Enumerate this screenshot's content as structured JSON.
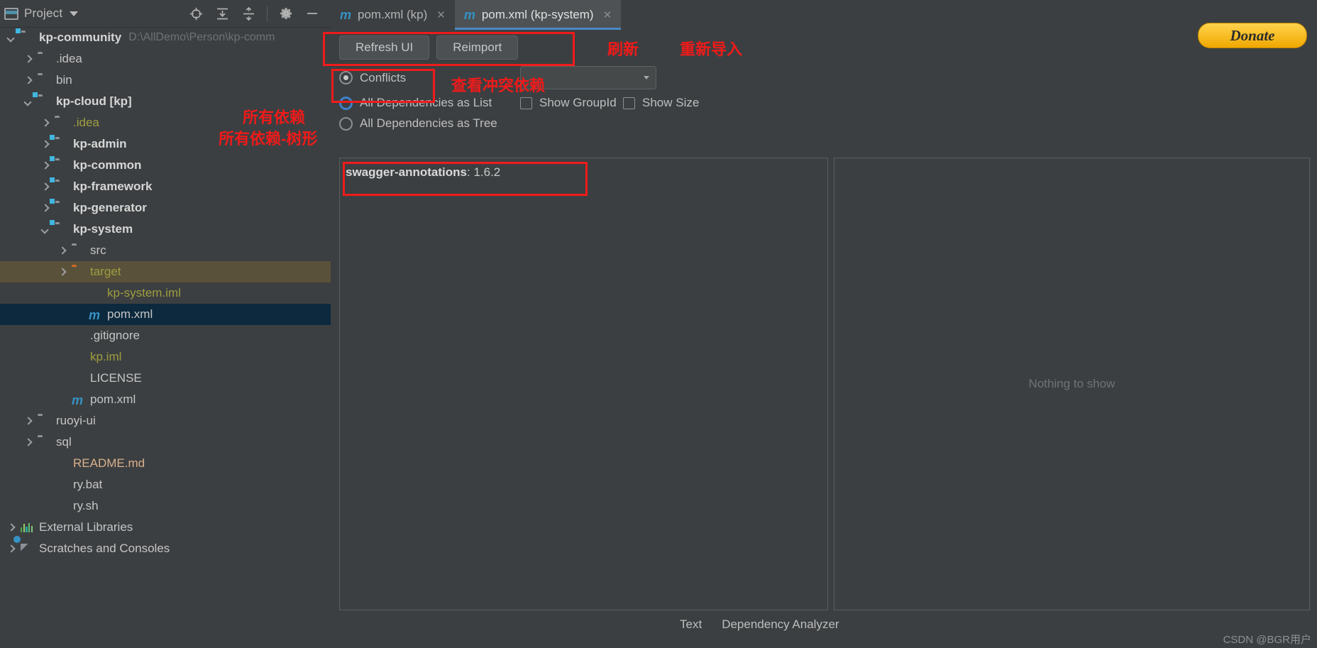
{
  "sidebar": {
    "title": "Project",
    "icons": [
      "project-window-icon",
      "chevron-down-icon",
      "locate-icon",
      "expand-all-icon",
      "collapse-all-icon",
      "gear-icon",
      "minimize-icon"
    ],
    "tree": [
      {
        "label": "kp-community",
        "path": "D:\\AllDemo\\Person\\kp-comm",
        "icon": "module-folder-icon",
        "arrow": "open",
        "indent": 0,
        "style": "bold"
      },
      {
        "label": ".idea",
        "icon": "folder-icon",
        "arrow": "closed",
        "indent": 1,
        "style": "normal"
      },
      {
        "label": "bin",
        "icon": "folder-icon",
        "arrow": "closed",
        "indent": 1,
        "style": "normal"
      },
      {
        "label": "kp-cloud [kp]",
        "icon": "module-folder-icon",
        "arrow": "open",
        "indent": 1,
        "style": "bold"
      },
      {
        "label": ".idea",
        "icon": "folder-icon",
        "arrow": "closed",
        "indent": 2,
        "style": "yellow"
      },
      {
        "label": "kp-admin",
        "icon": "module-folder-icon",
        "arrow": "closed",
        "indent": 2,
        "style": "bold"
      },
      {
        "label": "kp-common",
        "icon": "module-folder-icon",
        "arrow": "closed",
        "indent": 2,
        "style": "bold"
      },
      {
        "label": "kp-framework",
        "icon": "module-folder-icon",
        "arrow": "closed",
        "indent": 2,
        "style": "bold"
      },
      {
        "label": "kp-generator",
        "icon": "module-folder-icon",
        "arrow": "closed",
        "indent": 2,
        "style": "bold"
      },
      {
        "label": "kp-system",
        "icon": "module-folder-icon",
        "arrow": "open",
        "indent": 2,
        "style": "bold"
      },
      {
        "label": "src",
        "icon": "folder-icon",
        "arrow": "closed",
        "indent": 3,
        "style": "normal"
      },
      {
        "label": "target",
        "icon": "folder-excluded-icon",
        "arrow": "closed",
        "indent": 3,
        "style": "yellow",
        "row": "highlight"
      },
      {
        "label": "kp-system.iml",
        "icon": "iml-file-icon",
        "arrow": "none",
        "indent": 4,
        "style": "yellow"
      },
      {
        "label": "pom.xml",
        "icon": "maven-file-icon",
        "arrow": "none",
        "indent": 4,
        "style": "normal",
        "row": "selected"
      },
      {
        "label": ".gitignore",
        "icon": "gitignore-file-icon",
        "arrow": "none",
        "indent": 3,
        "style": "normal"
      },
      {
        "label": "kp.iml",
        "icon": "iml-file-icon",
        "arrow": "none",
        "indent": 3,
        "style": "yellow"
      },
      {
        "label": "LICENSE",
        "icon": "text-file-icon",
        "arrow": "none",
        "indent": 3,
        "style": "normal"
      },
      {
        "label": "pom.xml",
        "icon": "maven-file-icon",
        "arrow": "none",
        "indent": 3,
        "style": "normal"
      },
      {
        "label": "ruoyi-ui",
        "icon": "folder-icon",
        "arrow": "closed",
        "indent": 1,
        "style": "normal"
      },
      {
        "label": "sql",
        "icon": "folder-icon",
        "arrow": "closed",
        "indent": 1,
        "style": "normal"
      },
      {
        "label": "README.md",
        "icon": "markdown-file-icon",
        "arrow": "none",
        "indent": 2,
        "style": "peach"
      },
      {
        "label": "ry.bat",
        "icon": "bat-file-icon",
        "arrow": "none",
        "indent": 2,
        "style": "normal"
      },
      {
        "label": "ry.sh",
        "icon": "shell-file-icon",
        "arrow": "none",
        "indent": 2,
        "style": "normal"
      },
      {
        "label": "External Libraries",
        "icon": "libraries-icon",
        "arrow": "closed",
        "indent": 0,
        "style": "normal"
      },
      {
        "label": "Scratches and Consoles",
        "icon": "scratches-icon",
        "arrow": "closed",
        "indent": 0,
        "style": "normal"
      }
    ]
  },
  "tabs": [
    {
      "label": "pom.xml (kp)",
      "icon": "maven-file-icon",
      "active": false,
      "closable": true
    },
    {
      "label": "pom.xml (kp-system)",
      "icon": "maven-file-icon",
      "active": true,
      "closable": true
    }
  ],
  "analyzer": {
    "buttons": [
      {
        "label": "Refresh UI",
        "name": "refresh-ui-button"
      },
      {
        "label": "Reimport",
        "name": "reimport-button"
      }
    ],
    "radios": [
      {
        "label": "Conflicts",
        "selected": true,
        "focused": false
      },
      {
        "label": "All Dependencies as List",
        "selected": false,
        "focused": true
      },
      {
        "label": "All Dependencies as Tree",
        "selected": false,
        "focused": false
      }
    ],
    "checkboxes": [
      {
        "label": "Show GroupId",
        "checked": false
      },
      {
        "label": "Show Size",
        "checked": false
      }
    ],
    "scope_combo_value": "",
    "dependency": {
      "name": "swagger-annotations",
      "separator": ":",
      "version": "1.6.2"
    },
    "right_pane_empty_text": "Nothing to show"
  },
  "bottom_tabs": [
    {
      "label": "Text"
    },
    {
      "label": "Dependency Analyzer"
    }
  ],
  "donate": {
    "label": "Donate"
  },
  "annotations": [
    {
      "text": "刷新",
      "name": "annotation-refresh"
    },
    {
      "text": "重新导入",
      "name": "annotation-reimport"
    },
    {
      "text": "查看冲突依赖",
      "name": "annotation-view-conflicts"
    },
    {
      "text": "所有依赖",
      "name": "annotation-all-dependencies"
    },
    {
      "text": "所有依赖-树形",
      "name": "annotation-all-dependencies-tree"
    }
  ],
  "watermark": "CSDN @BGR用户",
  "colors": {
    "accent_blue": "#3592c4",
    "annotation_red": "#f01a1a",
    "selection_blue": "#0d293e",
    "highlight_row": "#5a513a",
    "panel_bg": "#3c3f41",
    "donate_gold": "#f0a800",
    "module_badge": "#40b6e0",
    "folder_gray": "#8b9199",
    "target_orange": "#cf6a29"
  }
}
